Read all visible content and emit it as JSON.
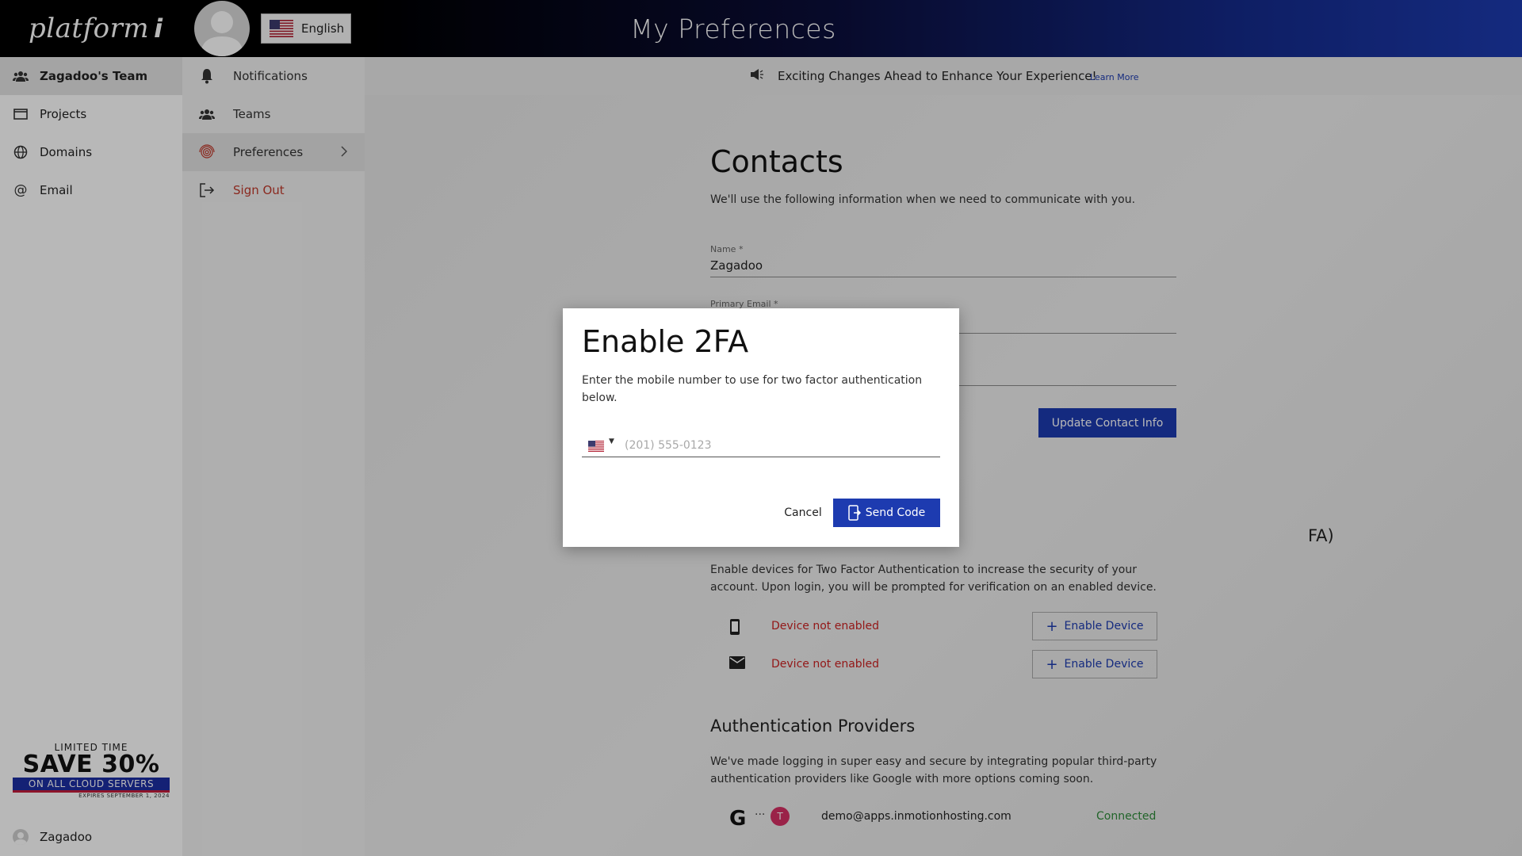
{
  "brand": {
    "logo_text": "platform",
    "logo_mark": "i"
  },
  "rail": {
    "items": [
      {
        "label": "Zagadoo's Team",
        "icon": "team-icon"
      },
      {
        "label": "Projects",
        "icon": "browser-window-icon"
      },
      {
        "label": "Domains",
        "icon": "globe-icon"
      },
      {
        "label": "Email",
        "icon": "at-sign-icon"
      }
    ],
    "promo": {
      "line1": "LIMITED TIME",
      "line2": "SAVE 30%",
      "line3": "ON ALL CLOUD SERVERS",
      "line4": "EXPIRES SEPTEMBER 1, 2024"
    },
    "user_name": "Zagadoo"
  },
  "account_menu": {
    "language": "English",
    "items": [
      {
        "label": "Notifications",
        "icon": "bell-icon"
      },
      {
        "label": "Teams",
        "icon": "team-icon"
      },
      {
        "label": "Preferences",
        "icon": "fingerprint-icon"
      },
      {
        "label": "Sign Out",
        "icon": "sign-out-icon"
      }
    ]
  },
  "header": {
    "title": "My Preferences"
  },
  "announcement": {
    "text": "Exciting Changes Ahead to Enhance Your Experience!",
    "link": "Learn More"
  },
  "contacts": {
    "title": "Contacts",
    "description": "We'll use the following information when we need to communicate with you.",
    "name_label": "Name *",
    "name_value": "Zagadoo",
    "email_label": "Primary Email *",
    "update_button": "Update Contact Info"
  },
  "two_factor": {
    "title_tail": "FA)",
    "description": "Enable devices for Two Factor Authentication to increase the security of your account. Upon login, you will be prompted for verification on an enabled device.",
    "devices": [
      {
        "icon": "mobile-phone-icon",
        "status": "Device not enabled",
        "button": "Enable Device"
      },
      {
        "icon": "mail-icon",
        "status": "Device not enabled",
        "button": "Enable Device"
      }
    ]
  },
  "auth_providers": {
    "title": "Authentication Providers",
    "description": "We've made logging in super easy and secure by integrating popular third-party authentication providers like Google with more options coming soon.",
    "provider_email": "demo@apps.inmotionhosting.com",
    "provider_status": "Connected",
    "provider_avatar_letter": "T"
  },
  "modal": {
    "title": "Enable 2FA",
    "description": "Enter the mobile number to use for two factor authentication below.",
    "phone_placeholder": "(201) 555-0123",
    "cancel": "Cancel",
    "send": "Send Code"
  },
  "colors": {
    "accent": "#1d3bb0",
    "danger": "#cc2222",
    "success": "#2e8b3a",
    "sign_out": "#c0392b"
  }
}
